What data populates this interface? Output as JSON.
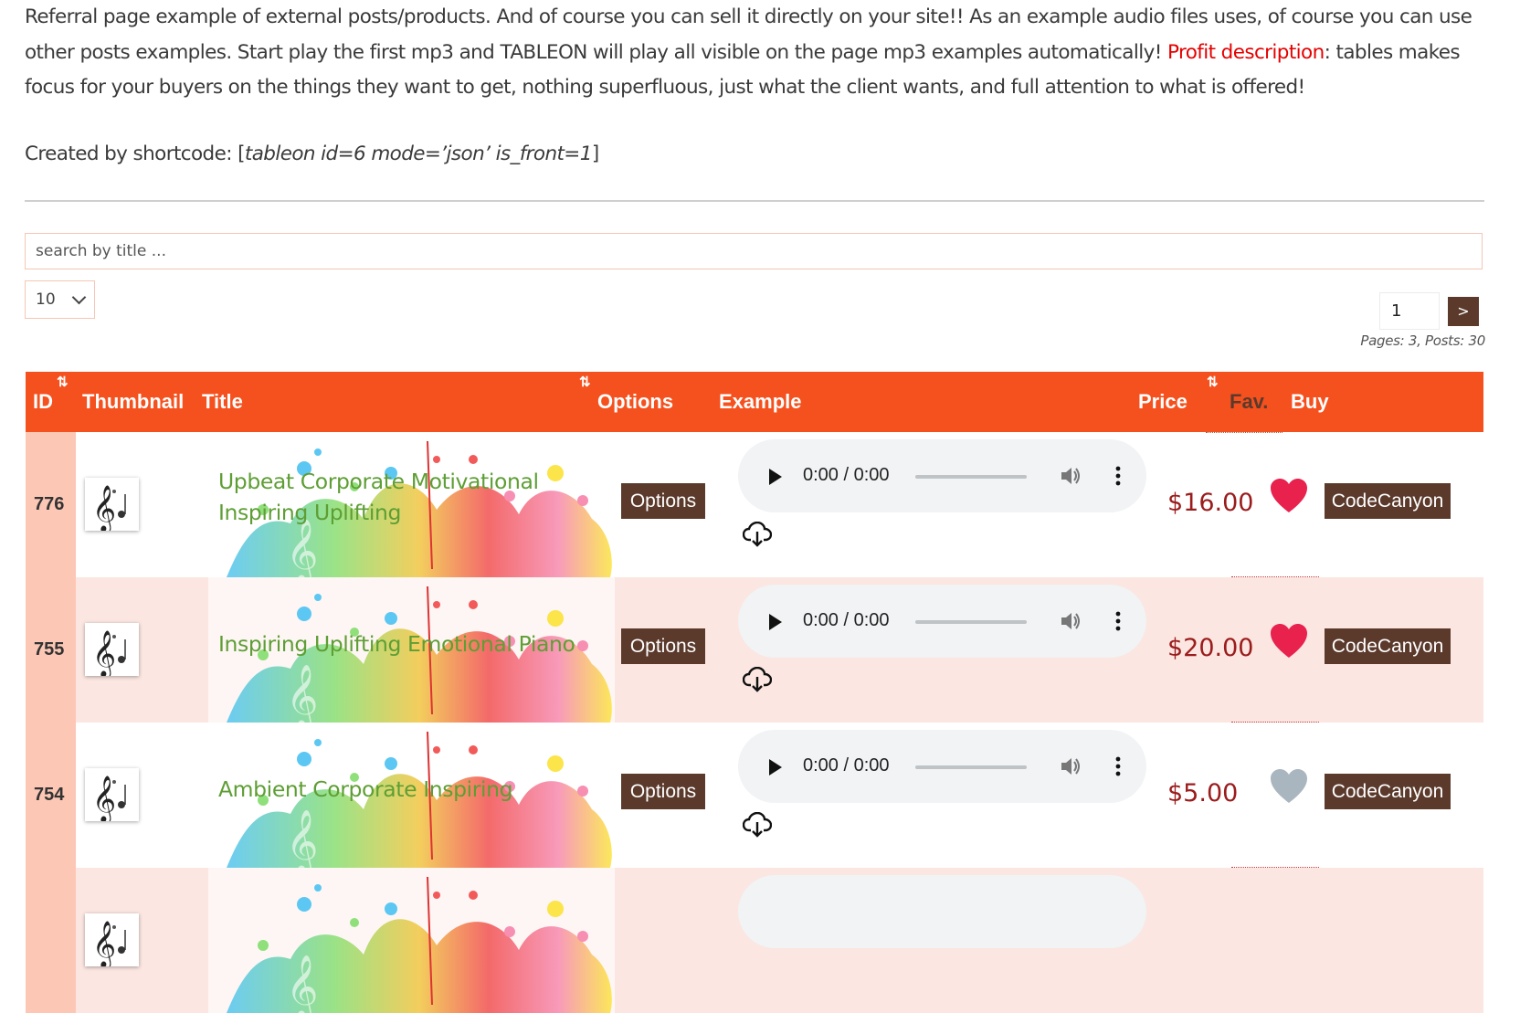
{
  "intro": {
    "text1": "Referral page example of external posts/products. And of course you can sell it directly on your site!! As an example audio files uses, of course you can use other posts examples. Start play the first mp3 and TABLEON will play all visible on the page mp3 examples automatically! ",
    "link": "Profit description",
    "text2": ": tables makes focus for your buyers on the things they want to get, nothing superfluous, just what the client wants, and full attention to what is offered!",
    "shortcode_label": "Created by shortcode: [",
    "shortcode": "tableon id=6 mode=’json’ is_front=1",
    "shortcode_end": "]"
  },
  "search": {
    "placeholder": "search by title ..."
  },
  "per_page": {
    "selected": "10"
  },
  "pagination": {
    "current": "1",
    "next": ">",
    "info": "Pages: 3, Posts: 30"
  },
  "columns": [
    "ID",
    "Thumbnail",
    "Title",
    "Options",
    "Example",
    "Price",
    "Fav.",
    "Buy"
  ],
  "sort_icon": "⇅",
  "rows": [
    {
      "id": "776",
      "title": "Upbeat Corporate Motivational Inspiring Uplifting",
      "options": "Options",
      "time": "0:00 / 0:00",
      "price": "$16.00",
      "fav": true,
      "buy": "CodeCanyon"
    },
    {
      "id": "755",
      "title": "Inspiring Uplifting Emotional Piano",
      "options": "Options",
      "time": "0:00 / 0:00",
      "price": "$20.00",
      "fav": true,
      "buy": "CodeCanyon"
    },
    {
      "id": "754",
      "title": "Ambient Corporate Inspiring",
      "options": "Options",
      "time": "0:00 / 0:00",
      "price": "$5.00",
      "fav": false,
      "buy": "CodeCanyon"
    },
    {
      "id": "",
      "title": "",
      "options": "",
      "time": "",
      "price": "",
      "fav": null,
      "buy": ""
    }
  ],
  "icons": {
    "thumbnail": "music-note-icon",
    "download": "cloud-download-icon",
    "favorite": "heart-icon",
    "volume": "volume-icon",
    "more": "more-vert-icon",
    "play": "play-icon"
  },
  "colors": {
    "header": "#f5511e",
    "button": "#5b3a2c",
    "id_cell": "#fcc8b5",
    "title_text": "#5e9e34",
    "price": "#9b1c1c",
    "fav_on": "#e8214d",
    "fav_off": "#aab6bf",
    "link_red": "#e50000"
  }
}
